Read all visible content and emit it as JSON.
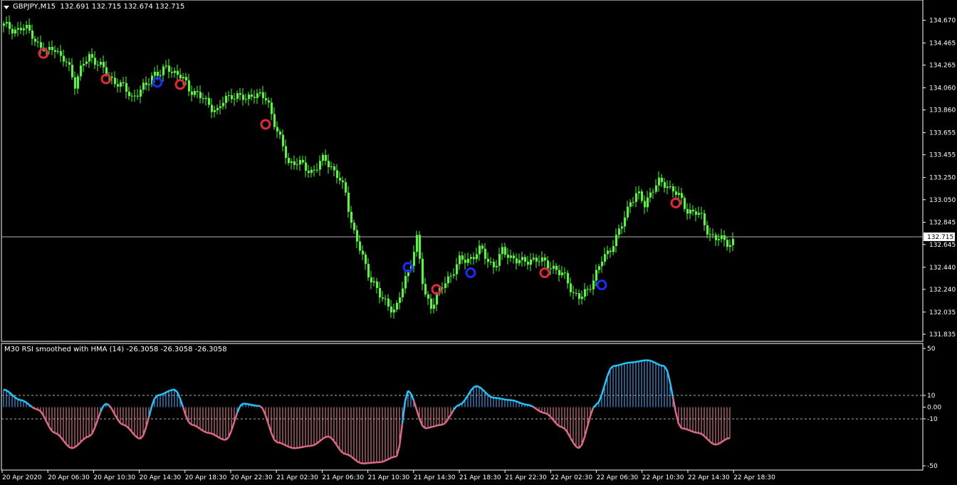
{
  "window": {
    "symbol_title": "GBPJPY,M15  132.691 132.715 132.674 132.715",
    "indicator_title": "M30 RSI smoothed with HMA (14) -26.3058 -26.3058 -26.3058"
  },
  "colors": {
    "background": "#000000",
    "candle": "#4cff2e",
    "grid_line": "#b0b0b0",
    "axis": "#ffffff",
    "arrow_down": "#e0283a",
    "arrow_up": "#1a2cff",
    "rsi_positive": "#5aaeff",
    "rsi_negative": "#f08a9a",
    "rsi_line_positive": "#1ec8ff",
    "rsi_line_negative": "#e06888"
  },
  "price_axis": {
    "ticks": [
      "134.670",
      "134.465",
      "134.265",
      "134.060",
      "133.860",
      "133.655",
      "133.455",
      "133.250",
      "133.050",
      "132.845",
      "132.645",
      "132.440",
      "132.240",
      "132.035",
      "131.835"
    ],
    "current_price_label": "132.715",
    "range": [
      131.79,
      134.75
    ]
  },
  "indicator_axis": {
    "ticks": [
      "50",
      "10",
      "0.00",
      "-10",
      "-50"
    ],
    "levels": [
      10,
      -10
    ]
  },
  "time_axis": {
    "labels": [
      "20 Apr 2020",
      "20 Apr 06:30",
      "20 Apr 10:30",
      "20 Apr 14:30",
      "20 Apr 18:30",
      "20 Apr 22:30",
      "21 Apr 02:30",
      "21 Apr 06:30",
      "21 Apr 10:30",
      "21 Apr 14:30",
      "21 Apr 18:30",
      "21 Apr 22:30",
      "22 Apr 02:30",
      "22 Apr 06:30",
      "22 Apr 10:30",
      "22 Apr 14:30",
      "22 Apr 18:30"
    ]
  },
  "chart_data": {
    "type": "candlestick",
    "symbol": "GBPJPY",
    "timeframe": "M15",
    "last": {
      "open": 132.691,
      "high": 132.715,
      "low": 132.674,
      "close": 132.715
    },
    "close_path": [
      [
        0,
        134.62
      ],
      [
        2,
        134.6
      ],
      [
        4,
        134.58
      ],
      [
        6,
        134.6
      ],
      [
        8,
        134.55
      ],
      [
        10,
        134.42
      ],
      [
        12,
        134.38
      ],
      [
        14,
        134.45
      ],
      [
        16,
        134.32
      ],
      [
        18,
        134.28
      ],
      [
        20,
        134.1
      ],
      [
        22,
        134.25
      ],
      [
        24,
        134.35
      ],
      [
        26,
        134.3
      ],
      [
        28,
        134.22
      ],
      [
        30,
        134.15
      ],
      [
        32,
        134.1
      ],
      [
        34,
        134.05
      ],
      [
        36,
        133.98
      ],
      [
        38,
        134.02
      ],
      [
        40,
        134.08
      ],
      [
        42,
        134.2
      ],
      [
        44,
        134.18
      ],
      [
        46,
        134.25
      ],
      [
        48,
        134.2
      ],
      [
        50,
        134.15
      ],
      [
        52,
        134.05
      ],
      [
        54,
        134.02
      ],
      [
        56,
        133.95
      ],
      [
        58,
        133.9
      ],
      [
        60,
        133.85
      ],
      [
        62,
        133.95
      ],
      [
        64,
        134.0
      ],
      [
        66,
        133.98
      ],
      [
        68,
        133.95
      ],
      [
        70,
        134.02
      ],
      [
        72,
        133.98
      ],
      [
        74,
        133.95
      ],
      [
        76,
        133.75
      ],
      [
        78,
        133.55
      ],
      [
        80,
        133.38
      ],
      [
        82,
        133.4
      ],
      [
        84,
        133.35
      ],
      [
        86,
        133.3
      ],
      [
        88,
        133.35
      ],
      [
        90,
        133.42
      ],
      [
        92,
        133.35
      ],
      [
        94,
        133.25
      ],
      [
        96,
        133.1
      ],
      [
        98,
        132.8
      ],
      [
        100,
        132.6
      ],
      [
        102,
        132.4
      ],
      [
        104,
        132.3
      ],
      [
        106,
        132.15
      ],
      [
        108,
        132.1
      ],
      [
        110,
        132.05
      ],
      [
        112,
        132.25
      ],
      [
        114,
        132.45
      ],
      [
        116,
        132.7
      ],
      [
        118,
        132.2
      ],
      [
        120,
        132.1
      ],
      [
        122,
        132.2
      ],
      [
        124,
        132.3
      ],
      [
        126,
        132.4
      ],
      [
        128,
        132.5
      ],
      [
        130,
        132.5
      ],
      [
        132,
        132.55
      ],
      [
        134,
        132.6
      ],
      [
        136,
        132.5
      ],
      [
        138,
        132.45
      ],
      [
        140,
        132.58
      ],
      [
        142,
        132.55
      ],
      [
        144,
        132.5
      ],
      [
        146,
        132.48
      ],
      [
        148,
        132.52
      ],
      [
        150,
        132.5
      ],
      [
        152,
        132.48
      ],
      [
        154,
        132.45
      ],
      [
        156,
        132.38
      ],
      [
        158,
        132.35
      ],
      [
        160,
        132.2
      ],
      [
        162,
        132.15
      ],
      [
        164,
        132.25
      ],
      [
        166,
        132.35
      ],
      [
        168,
        132.5
      ],
      [
        170,
        132.6
      ],
      [
        172,
        132.7
      ],
      [
        174,
        132.85
      ],
      [
        176,
        133.05
      ],
      [
        178,
        133.1
      ],
      [
        180,
        133.0
      ],
      [
        182,
        133.15
      ],
      [
        184,
        133.2
      ],
      [
        186,
        133.18
      ],
      [
        188,
        133.15
      ],
      [
        190,
        133.05
      ],
      [
        192,
        132.95
      ],
      [
        194,
        132.95
      ],
      [
        196,
        132.88
      ],
      [
        198,
        132.75
      ],
      [
        200,
        132.7
      ],
      [
        202,
        132.68
      ],
      [
        204,
        132.66
      ],
      [
        206,
        132.7
      ]
    ],
    "signals_down": [
      [
        14,
        134.37
      ],
      [
        36,
        134.14
      ],
      [
        62,
        134.09
      ],
      [
        92,
        133.73
      ],
      [
        152,
        132.24
      ],
      [
        190,
        132.39
      ],
      [
        236,
        133.02
      ]
    ],
    "signals_up": [
      [
        54,
        134.11
      ],
      [
        142,
        132.44
      ],
      [
        164,
        132.39
      ],
      [
        210,
        132.28
      ]
    ],
    "rsi_hma": [
      [
        0,
        15.0
      ],
      [
        6,
        6.0
      ],
      [
        12,
        -2.0
      ],
      [
        18,
        -22.0
      ],
      [
        24,
        -35.0
      ],
      [
        30,
        -25.0
      ],
      [
        36,
        3.0
      ],
      [
        42,
        -15.0
      ],
      [
        48,
        -27.0
      ],
      [
        54,
        10.0
      ],
      [
        60,
        15.0
      ],
      [
        66,
        -15.0
      ],
      [
        72,
        -22.0
      ],
      [
        78,
        -28.0
      ],
      [
        84,
        3.0
      ],
      [
        90,
        1.0
      ],
      [
        96,
        -30.0
      ],
      [
        102,
        -35.0
      ],
      [
        108,
        -33.0
      ],
      [
        114,
        -25.0
      ],
      [
        120,
        -40.0
      ],
      [
        126,
        -48.0
      ],
      [
        132,
        -47.0
      ],
      [
        138,
        -42.0
      ],
      [
        142,
        14.0
      ],
      [
        148,
        -18.0
      ],
      [
        154,
        -15.0
      ],
      [
        160,
        2.0
      ],
      [
        166,
        18.0
      ],
      [
        172,
        8.0
      ],
      [
        178,
        6.0
      ],
      [
        184,
        2.0
      ],
      [
        190,
        -5.0
      ],
      [
        196,
        -17.0
      ],
      [
        202,
        -35.0
      ],
      [
        208,
        2.0
      ],
      [
        214,
        35.0
      ],
      [
        220,
        38.0
      ],
      [
        226,
        40.0
      ],
      [
        232,
        35.0
      ],
      [
        238,
        -18.0
      ],
      [
        244,
        -22.0
      ],
      [
        250,
        -32.0
      ],
      [
        255,
        -26.3058
      ]
    ],
    "current_price": 132.715
  }
}
